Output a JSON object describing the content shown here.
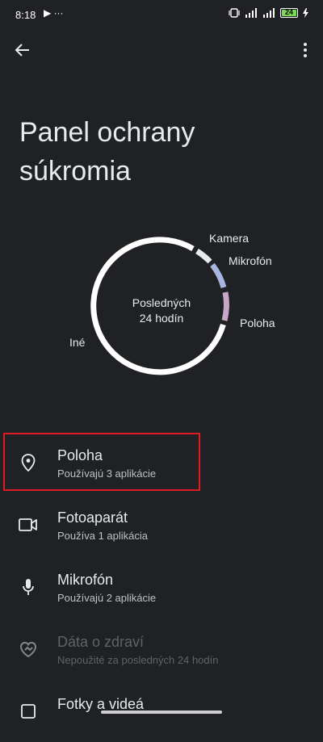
{
  "status": {
    "time": "8:18",
    "left_icons": "▶ ···",
    "battery": "24"
  },
  "page": {
    "title_line1": "Panel ochrany",
    "title_line2": "súkromia"
  },
  "chart_data": {
    "type": "donut",
    "center_line1": "Posledných",
    "center_line2": "24 hodín",
    "segments": [
      {
        "name": "Kamera",
        "color": "#e8eaed"
      },
      {
        "name": "Mikrofón",
        "color": "#a7b6e0"
      },
      {
        "name": "Poloha",
        "color": "#c7a6c7"
      },
      {
        "name": "Iné",
        "color": "#ffffff"
      }
    ]
  },
  "list": [
    {
      "title": "Poloha",
      "subtitle": "Používajú 3 aplikácie",
      "icon": "location-icon",
      "enabled": true
    },
    {
      "title": "Fotoaparát",
      "subtitle": "Používa 1 aplikácia",
      "icon": "camera-icon",
      "enabled": true
    },
    {
      "title": "Mikrofón",
      "subtitle": "Používajú 2 aplikácie",
      "icon": "microphone-icon",
      "enabled": true
    },
    {
      "title": "Dáta o zdraví",
      "subtitle": "Nepoužité za posledných 24 hodín",
      "icon": "health-icon",
      "enabled": false
    },
    {
      "title": "Fotky a videá",
      "subtitle": "",
      "icon": "photos-icon",
      "enabled": true
    }
  ]
}
